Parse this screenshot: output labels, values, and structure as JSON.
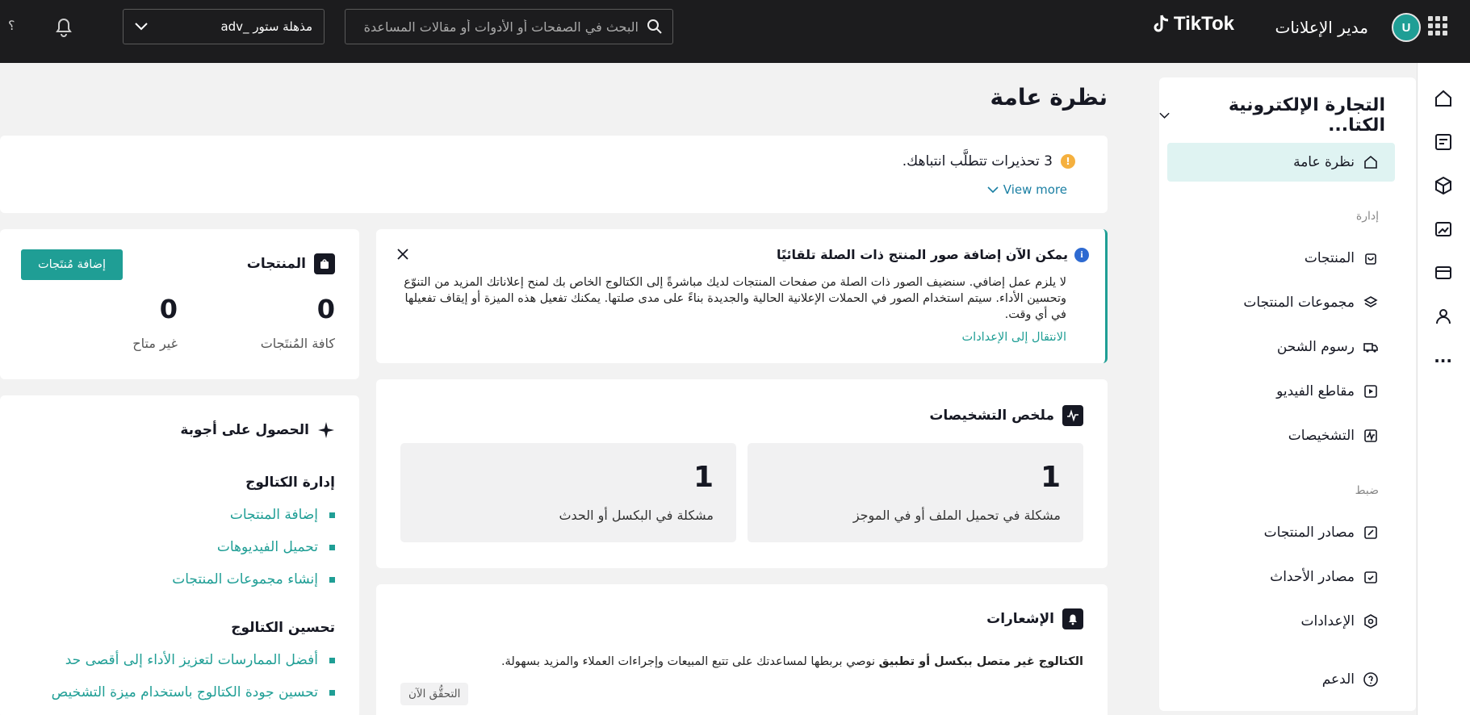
{
  "topbar": {
    "brand_title": "مدير الإعلانات",
    "brand_logo": "TikTok",
    "avatar_letter": "U",
    "search_placeholder": "البحث في الصفحات أو الأدوات أو مقالات المساعدة",
    "account_name": "مذهلة ستور _adv",
    "help": "؟"
  },
  "sidenav": {
    "store_title": "التجارة الإلكترونية الكتا...",
    "overview": "نظرة عامة",
    "section_manage": "إدارة",
    "items_manage": [
      "المنتجات",
      "مجموعات المنتجات",
      "رسوم الشحن",
      "مقاطع الفيديو",
      "التشخيصات"
    ],
    "section_settings": "ضبط",
    "items_settings": [
      "مصادر المنتجات",
      "مصادر الأحداث",
      "الإعدادات"
    ],
    "support": "الدعم"
  },
  "rail": {
    "more": "..."
  },
  "main": {
    "title": "نظرة عامة",
    "warning": {
      "text": "3 تحذيرات تتطلَّب انتباهك.",
      "view_more": "View more"
    },
    "info": {
      "title": "يمكن الآن إضافة صور المنتج ذات الصلة تلقائيًا",
      "body": "لا يلزم عمل إضافي. سنضيف الصور ذات الصلة من صفحات المنتجات لديك مباشرةً إلى الكتالوج الخاص بك لمنح إعلاناتك المزيد من التنوّع وتحسين الأداء. سيتم استخدام الصور في الحملات الإعلانية الحالية والجديدة بناءً على مدى صلتها. يمكنك تفعيل هذه الميزة أو إيقاف تفعيلها في أي وقت.",
      "link": "الانتقال إلى الإعدادات"
    },
    "diagnostics": {
      "title": "ملخص التشخيصات",
      "stats": [
        {
          "value": "1",
          "label": "مشكلة في تحميل الملف أو في الموجز"
        },
        {
          "value": "1",
          "label": "مشكلة في البكسل أو الحدث"
        }
      ]
    },
    "notifications": {
      "title": "الإشعارات",
      "bold": "الكتالوج غير متصل ببكسل أو تطبيق",
      "rest": " نوصي بربطها لمساعدتك على تتبع المبيعات وإجراءات العملاء والمزيد بسهولة.",
      "check_now": "التحقُّق الآن"
    },
    "products": {
      "title": "المنتجات",
      "add_button": "إضافة مُنتَجات",
      "all_value": "0",
      "all_label": "كافة المُنتَجات",
      "unavailable_value": "0",
      "unavailable_label": "غير متاح"
    },
    "answers": {
      "title": "الحصول على أجوبة",
      "section1": "إدارة الكتالوج",
      "links1": [
        "إضافة المنتجات",
        "تحميل الفيديوهات",
        "إنشاء مجموعات المنتجات"
      ],
      "section2": "تحسين الكتالوج",
      "links2": [
        "أفضل الممارسات لتعزيز الأداء إلى أقصى حد",
        "تحسين جودة الكتالوج باستخدام ميزة التشخيص"
      ]
    }
  }
}
